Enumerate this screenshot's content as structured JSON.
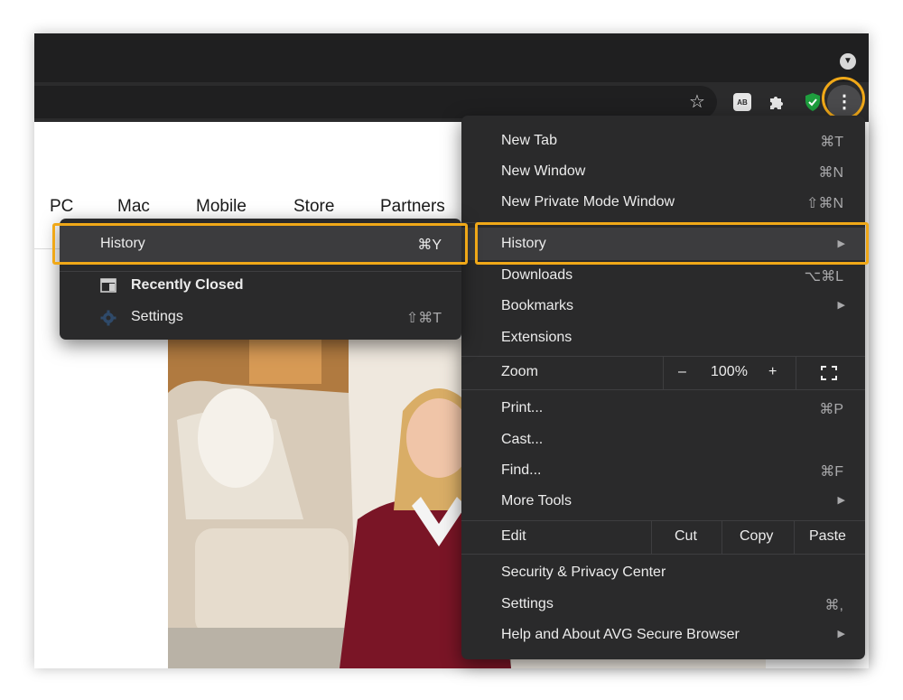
{
  "colors": {
    "accent": "#f0a818",
    "menu_bg": "#2a2a2b",
    "highlight_bg": "#3c3c3e",
    "toolbar_bg": "#2b2b2c"
  },
  "toolbar": {
    "icons": [
      "star-icon",
      "adblock-icon",
      "puzzle-icon",
      "shield-icon",
      "menu-dots-icon"
    ],
    "adblock_text": "AB"
  },
  "site_nav": [
    "PC",
    "Mac",
    "Mobile",
    "Store",
    "Partners"
  ],
  "menu": {
    "new_tab": {
      "label": "New Tab",
      "shortcut": "⌘T"
    },
    "new_window": {
      "label": "New Window",
      "shortcut": "⌘N"
    },
    "new_private": {
      "label": "New Private Mode Window",
      "shortcut": "⇧⌘N"
    },
    "history": {
      "label": "History"
    },
    "downloads": {
      "label": "Downloads",
      "shortcut": "⌥⌘L"
    },
    "bookmarks": {
      "label": "Bookmarks"
    },
    "extensions": {
      "label": "Extensions"
    },
    "zoom": {
      "label": "Zoom",
      "minus": "–",
      "value": "100%",
      "plus": "+"
    },
    "print": {
      "label": "Print...",
      "shortcut": "⌘P"
    },
    "cast": {
      "label": "Cast..."
    },
    "find": {
      "label": "Find...",
      "shortcut": "⌘F"
    },
    "more_tools": {
      "label": "More Tools"
    },
    "edit": {
      "label": "Edit",
      "cut": "Cut",
      "copy": "Copy",
      "paste": "Paste"
    },
    "security": {
      "label": "Security & Privacy Center"
    },
    "settings": {
      "label": "Settings",
      "shortcut": "⌘,"
    },
    "help": {
      "label": "Help and About AVG Secure Browser"
    }
  },
  "submenu": {
    "history": {
      "label": "History",
      "shortcut": "⌘Y"
    },
    "recently_closed": {
      "label": "Recently Closed"
    },
    "settings": {
      "label": "Settings",
      "shortcut": "⇧⌘T"
    }
  }
}
